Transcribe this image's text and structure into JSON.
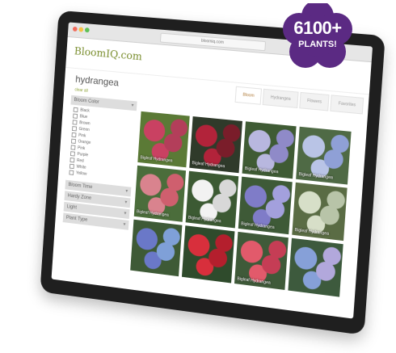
{
  "browser": {
    "url": "bloomiq.com"
  },
  "site": {
    "logo_text": "BloomIQ.com"
  },
  "search": {
    "query": "hydrangea",
    "clear_all": "clear all"
  },
  "tabs": [
    {
      "label": "Bloom"
    },
    {
      "label": "Hydrangea"
    },
    {
      "label": "Flowers"
    },
    {
      "label": "Favorites"
    }
  ],
  "filters": {
    "bloom_color": {
      "label": "Bloom Color",
      "options": [
        "Black",
        "Blue",
        "Brown",
        "Green",
        "Pink",
        "Orange",
        "Pink",
        "Purple",
        "Red",
        "White",
        "Yellow"
      ]
    },
    "collapsed": [
      {
        "label": "Bloom Time"
      },
      {
        "label": "Hardy Zone"
      },
      {
        "label": "Light"
      },
      {
        "label": "Plant Type"
      }
    ]
  },
  "results": [
    {
      "caption": "Bigleaf Hydrangea",
      "colors": [
        "#5b7a36",
        "#c94162",
        "#b33e5a"
      ]
    },
    {
      "caption": "Bigleaf Hydrangea",
      "colors": [
        "#2f3a2a",
        "#b2233a",
        "#7a1d2a"
      ]
    },
    {
      "caption": "Bigleaf Hydrangea",
      "colors": [
        "#3f5b34",
        "#b8b7df",
        "#8f8ac8"
      ]
    },
    {
      "caption": "Bigleaf Hydrangea",
      "colors": [
        "#4f6a45",
        "#b9c4e6",
        "#8fa0d6"
      ]
    },
    {
      "caption": "Bigleaf Hydrangea",
      "colors": [
        "#4b6d3b",
        "#d9838e",
        "#cf5f6e"
      ]
    },
    {
      "caption": "Bigleaf Hydrangea",
      "colors": [
        "#3c5a33",
        "#f2f2f2",
        "#d8d8d8"
      ]
    },
    {
      "caption": "Bigleaf Hydrangea",
      "colors": [
        "#3e5a37",
        "#7f7cc8",
        "#a3a0dd"
      ]
    },
    {
      "caption": "Bigleaf Hydrangea",
      "colors": [
        "#5a6c44",
        "#d7dfc8",
        "#b8c4a8"
      ]
    },
    {
      "caption": "",
      "colors": [
        "#3e5a36",
        "#6a78c8",
        "#7fa0d8"
      ]
    },
    {
      "caption": "",
      "colors": [
        "#2f4b2c",
        "#d82f3c",
        "#b41f2d"
      ]
    },
    {
      "caption": "Bigleaf Hydrangea",
      "colors": [
        "#3f5a39",
        "#e25a6b",
        "#c53d55"
      ]
    },
    {
      "caption": "",
      "colors": [
        "#3d5a3d",
        "#86a0d8",
        "#b2a8dc"
      ]
    }
  ],
  "promo": {
    "line1": "6100+",
    "line2": "PLANTS!",
    "color": "#5b2a83"
  }
}
